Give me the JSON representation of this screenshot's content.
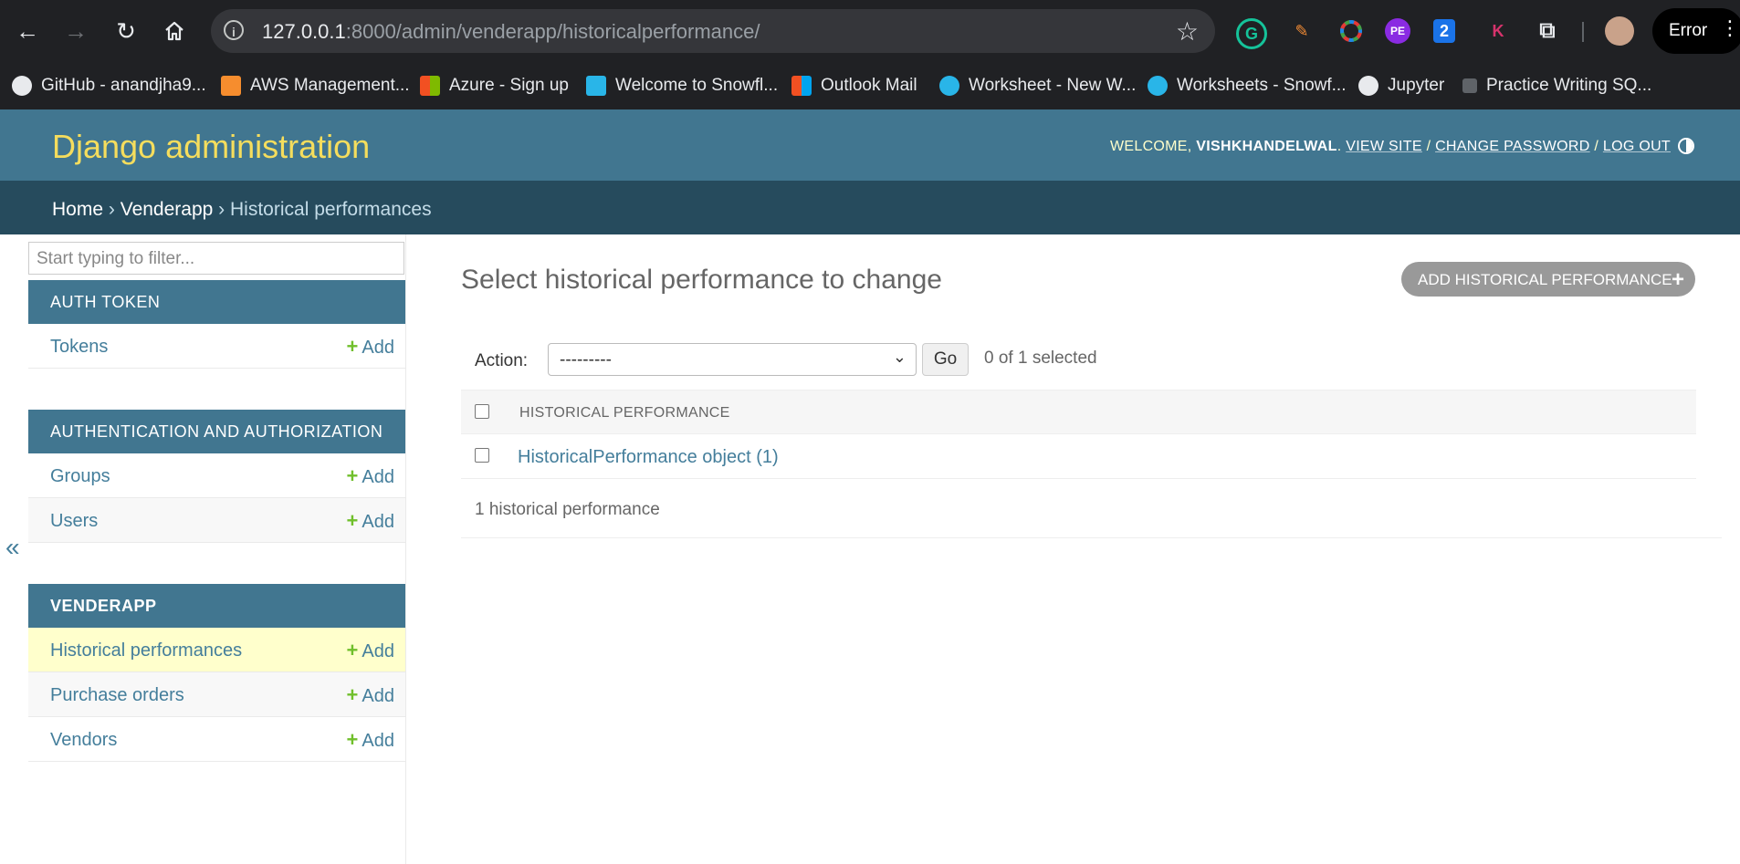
{
  "browser": {
    "url_host": "127.0.0.1",
    "url_rest": ":8000/admin/venderapp/historicalperformance/",
    "error_label": "Error",
    "extensions": [
      "grammarly-icon",
      "pen-icon",
      "color-wheel-icon",
      "pe-extension-icon",
      "two-extension-icon",
      "k-extension-icon",
      "puzzle-icon"
    ],
    "ext_pe": "PE",
    "ext_two": "2",
    "ext_k": "K",
    "bookmarks": [
      "GitHub - anandjha9...",
      "AWS Management...",
      "Azure - Sign up",
      "Welcome to Snowfl...",
      "Outlook Mail",
      "Worksheet - New W...",
      "Worksheets - Snowf...",
      "Jupyter",
      "Practice Writing SQ..."
    ]
  },
  "header": {
    "branding": "Django administration",
    "welcome": "WELCOME,",
    "username": "VISHKHANDELWAL",
    "view_site": "VIEW SITE",
    "change_password": "CHANGE PASSWORD",
    "log_out": "LOG OUT",
    "sep": "/"
  },
  "breadcrumbs": {
    "home": "Home",
    "app": "Venderapp",
    "current": "Historical performances",
    "sep": "›"
  },
  "sidebar": {
    "filter_placeholder": "Start typing to filter...",
    "collapse": "«",
    "add_label": "Add",
    "apps": [
      {
        "name": "AUTH TOKEN",
        "models": [
          "Tokens"
        ]
      },
      {
        "name": "AUTHENTICATION AND AUTHORIZATION",
        "models": [
          "Groups",
          "Users"
        ]
      },
      {
        "name": "VENDERAPP",
        "models": [
          "Historical performances",
          "Purchase orders",
          "Vendors"
        ]
      }
    ]
  },
  "content": {
    "title": "Select historical performance to change",
    "add_button": "ADD HISTORICAL PERFORMANCE",
    "action_label": "Action:",
    "action_value": "---------",
    "go_label": "Go",
    "selected_count": "0 of 1 selected",
    "column_header": "HISTORICAL PERFORMANCE",
    "rows": [
      "HistoricalPerformance object (1)"
    ],
    "paginator": "1 historical performance"
  },
  "colors": {
    "header_bg": "#417690",
    "breadcrumb_bg": "#264b5d",
    "branding": "#f5dd5d",
    "link": "#447e9b",
    "add_green": "#70bf2b",
    "selected_row": "#ffffcc"
  }
}
